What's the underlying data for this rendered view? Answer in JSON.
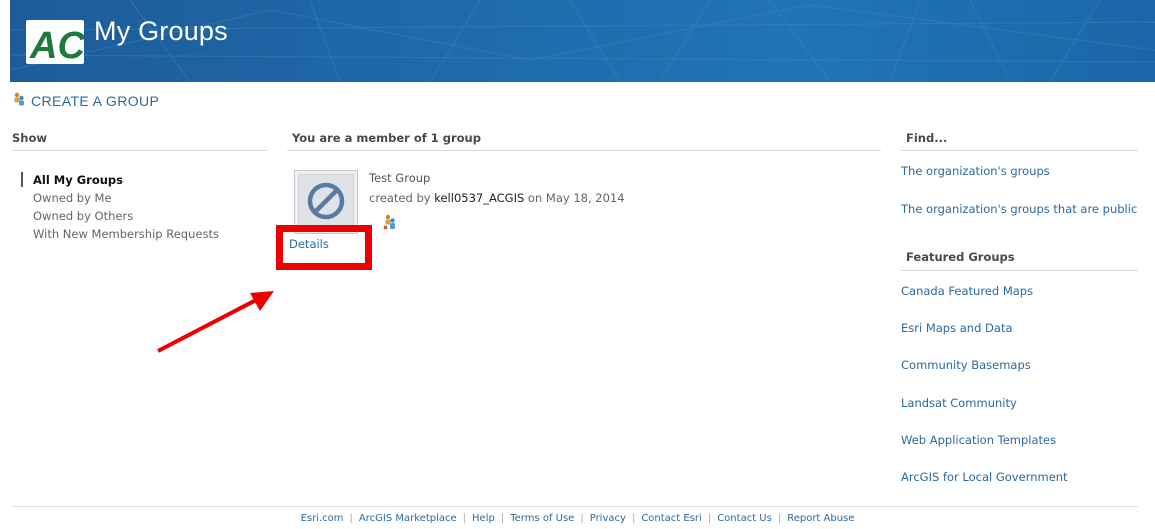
{
  "header": {
    "title": "My Groups",
    "logo_text": "AC",
    "banner_color": "#1f6aab",
    "logo_color": "#1e7a3b"
  },
  "create_group": {
    "label": "CREATE A GROUP",
    "icon": "group-people-icon"
  },
  "left": {
    "heading": "Show",
    "items": [
      {
        "label": "All My Groups",
        "active": true
      },
      {
        "label": "Owned by Me"
      },
      {
        "label": "Owned by Others"
      },
      {
        "label": "With New Membership Requests"
      }
    ]
  },
  "main": {
    "heading": "You are a member of 1 group",
    "group": {
      "title": "Test Group",
      "created_prefix": "created by",
      "owner": "kell0537_ACGIS",
      "date_prefix": "on",
      "date": "May 18, 2014",
      "thumbnail_icon": "no-image-icon",
      "details_label": "Details",
      "owner_icon": "group-owner-icon"
    }
  },
  "right": {
    "find_heading": "Find...",
    "find_links": [
      "The organization's groups",
      "The organization's groups that are public"
    ],
    "featured_heading": "Featured Groups",
    "featured_links": [
      "Canada Featured Maps",
      "Esri Maps and Data",
      "Community Basemaps",
      "Landsat Community",
      "Web Application Templates",
      "ArcGIS for Local Government"
    ]
  },
  "footer": {
    "links": [
      "Esri.com",
      "ArcGIS Marketplace",
      "Help",
      "Terms of Use",
      "Privacy",
      "Contact Esri",
      "Contact Us",
      "Report Abuse"
    ],
    "separator": "|"
  },
  "annotation": {
    "highlight_color": "#ee0000"
  }
}
